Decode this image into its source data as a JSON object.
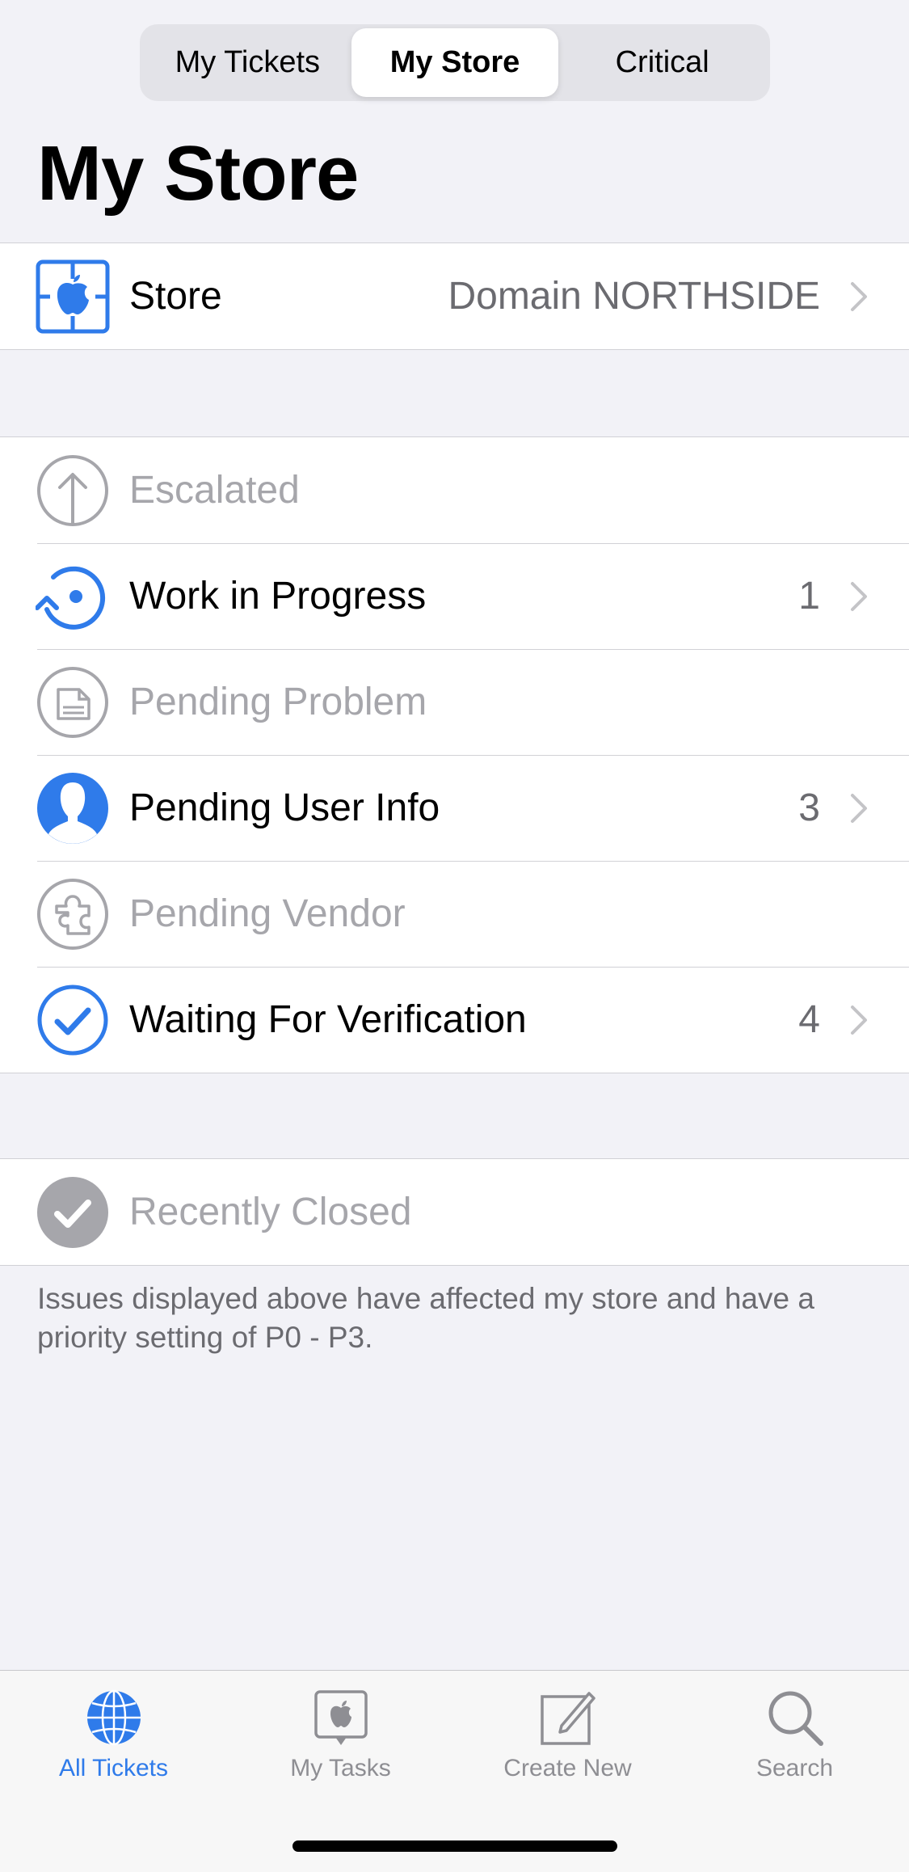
{
  "segmented": {
    "tabs": [
      {
        "label": "My Tickets"
      },
      {
        "label": "My Store"
      },
      {
        "label": "Critical"
      }
    ],
    "selected": "My Store"
  },
  "title": "My Store",
  "store_row": {
    "label": "Store",
    "value": "Domain NORTHSIDE",
    "icon": "store-apple-icon"
  },
  "status_rows": [
    {
      "label": "Escalated",
      "count": "",
      "icon": "escalated-arrow-up-icon",
      "enabled": false
    },
    {
      "label": "Work in Progress",
      "count": "1",
      "icon": "work-in-progress-icon",
      "enabled": true
    },
    {
      "label": "Pending Problem",
      "count": "",
      "icon": "pending-problem-icon",
      "enabled": false
    },
    {
      "label": "Pending User Info",
      "count": "3",
      "icon": "user-silhouette-icon",
      "enabled": true
    },
    {
      "label": "Pending Vendor",
      "count": "",
      "icon": "puzzle-icon",
      "enabled": false
    },
    {
      "label": "Waiting For Verification",
      "count": "4",
      "icon": "checkmark-circle-icon",
      "enabled": true
    }
  ],
  "closed_row": {
    "label": "Recently Closed",
    "icon": "closed-check-icon",
    "enabled": false
  },
  "footer_note": "Issues displayed above have affected my store and have a priority setting of P0 - P3.",
  "tabbar": [
    {
      "label": "All Tickets",
      "icon": "globe-icon",
      "active": true
    },
    {
      "label": "My Tasks",
      "icon": "apple-tasks-icon",
      "active": false
    },
    {
      "label": "Create New",
      "icon": "compose-icon",
      "active": false
    },
    {
      "label": "Search",
      "icon": "search-icon",
      "active": false
    }
  ],
  "colors": {
    "accent": "#2f7bea",
    "disabled": "#a6a6ab",
    "background": "#f2f2f7"
  }
}
